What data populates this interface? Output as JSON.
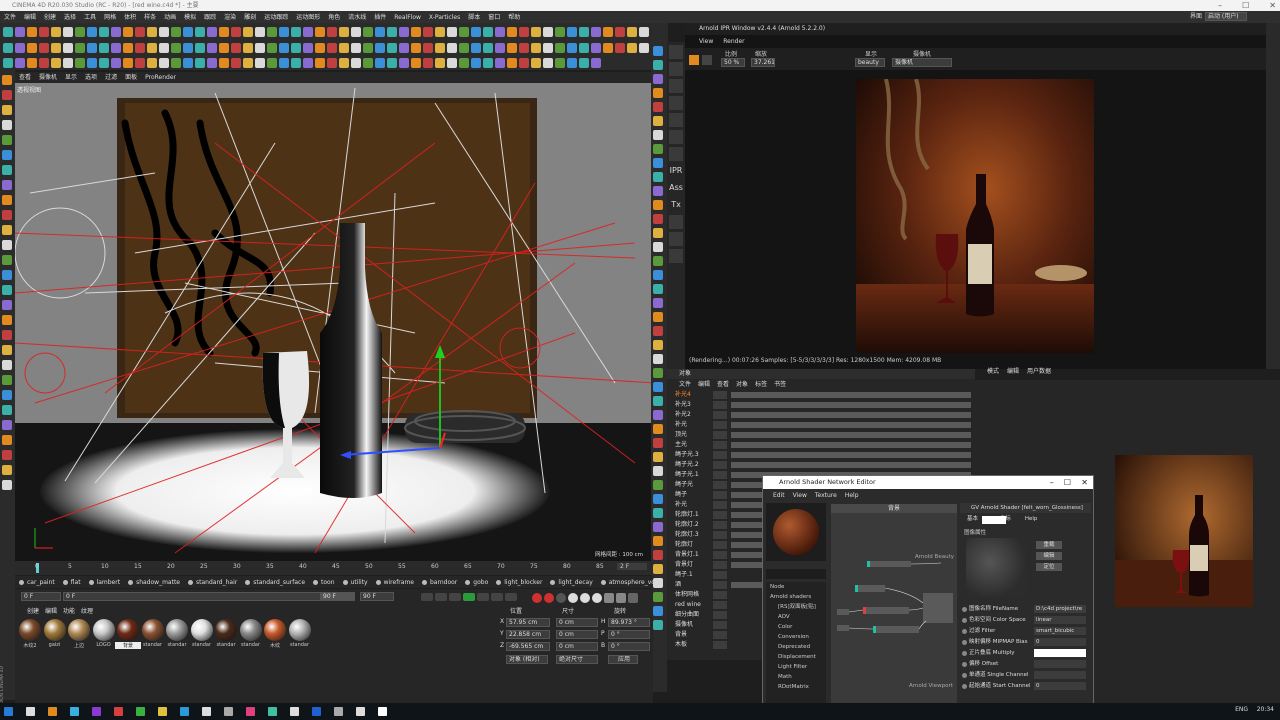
{
  "app": {
    "title": "CINEMA 4D R20.030 Studio (RC - R20) - [red wine.c4d *] - 主要",
    "layout_label": "界面",
    "layout_value": "启动 (用户)",
    "side_label": "MAXON CINEMA 4D"
  },
  "main_menu": [
    "文件",
    "编辑",
    "创建",
    "选择",
    "工具",
    "网格",
    "体积",
    "样条",
    "动画",
    "模拟",
    "跟踪",
    "渲染",
    "雕刻",
    "运动跟踪",
    "运动图形",
    "角色",
    "流水线",
    "插件",
    "RealFlow",
    "X-Particles",
    "脚本",
    "窗口",
    "帮助"
  ],
  "viewport": {
    "menu": [
      "查看",
      "摄像机",
      "显示",
      "选项",
      "过滤",
      "面板",
      "ProRender"
    ],
    "label": "透视视图",
    "grid_spacing": "网格间距 : 100 cm"
  },
  "right_toolbar": [
    "IPR",
    "Ass",
    "Tx"
  ],
  "arnold_ipr": {
    "title": "Arnold IPR Window v2.4.4 (Arnold 5.2.2.0)",
    "menu": [
      "View",
      "Render"
    ],
    "ratio_label": "比例",
    "zoom_label": "缩放",
    "display_label": "显示",
    "camera_label": "摄像机",
    "ratio_value": "50 %",
    "zoom_value": "37.261",
    "display_value": "beauty",
    "camera_value": "摄像机",
    "status": "(Rendering...) 00:07:26  Samples: [5-5/3/3/3/3/3]  Res: 1280x1500  Mem: 4209.08 MB"
  },
  "objects": {
    "header": "对象",
    "menu": [
      "文件",
      "编辑",
      "查看",
      "对象",
      "标签",
      "书签"
    ],
    "rows": [
      "补光4",
      "补光3",
      "补光2",
      "补光",
      "顶光",
      "主光",
      "绳子光.3",
      "绳子光.2",
      "绳子光.1",
      "绳子光",
      "绳子",
      "补光",
      "轮廓灯.1",
      "轮廓灯.2",
      "轮廓灯.3",
      "轮廓灯",
      "背景灯.1",
      "背景灯",
      "绳子.1",
      "酒",
      "体积网格",
      "red wine",
      "细分曲面",
      "摄像机",
      "背景",
      "木板"
    ]
  },
  "attributes": {
    "menu": [
      "模式",
      "编辑",
      "用户数据"
    ]
  },
  "shader_editor": {
    "title": "Arnold Shader Network Editor",
    "menu": [
      "Edit",
      "View",
      "Texture",
      "Help"
    ],
    "graph_title": "背景",
    "tree_header": "Node",
    "tree": [
      "Arnold shaders",
      "[RS]双面板[贴]",
      "AOV",
      "Color",
      "Conversion",
      "Deprecated",
      "Displacement",
      "Light Filter",
      "Math",
      "RDotMatrix"
    ],
    "beauty_label": "Arnold Beauty",
    "viewport_label": "Arnold Viewport",
    "node_title": "GV Arnold Shader [felt_worn_Glossiness]",
    "tabs": [
      "基本",
      "UV坐标",
      "Help"
    ],
    "section": "图像属性",
    "buttons": [
      "重载",
      "编辑",
      "定位"
    ],
    "params": [
      {
        "label": "图像名称 FileName",
        "value": "D:\\c4d project\\re"
      },
      {
        "label": "色彩空间 Color Space",
        "value": "linear"
      },
      {
        "label": "过滤 Filter",
        "value": "smart_bicubic"
      },
      {
        "label": "映射偏移 MIPMAP Bias",
        "value": "0"
      },
      {
        "label": "正片叠底 Multiply",
        "value": ""
      },
      {
        "label": "偏移 Offset",
        "value": ""
      },
      {
        "label": "单通道 Single Channel",
        "value": ""
      },
      {
        "label": "起始通道 Start Channel",
        "value": "0"
      }
    ]
  },
  "timeline": {
    "ticks": [
      "0",
      "5",
      "10",
      "15",
      "20",
      "25",
      "30",
      "35",
      "40",
      "45",
      "50",
      "55",
      "60",
      "65",
      "70",
      "75",
      "80",
      "85",
      "90"
    ],
    "current": "2 F",
    "start": "0 F",
    "start2": "0 F",
    "end": "90 F",
    "end2": "90 F"
  },
  "material_tags": [
    "car_paint",
    "flat",
    "lambert",
    "shadow_matte",
    "standard_hair",
    "standard_surface",
    "toon",
    "utility",
    "wireframe",
    "barndoor",
    "gobo",
    "light_blocker",
    "light_decay",
    "atmosphere_volume",
    "fog"
  ],
  "materials": {
    "menu": [
      "创建",
      "编辑",
      "功能",
      "纹理"
    ],
    "items": [
      {
        "name": "木纹2",
        "color": "#7a4a2a"
      },
      {
        "name": "gaizi",
        "color": "#a07a3a"
      },
      {
        "name": "上边",
        "color": "#b08a55"
      },
      {
        "name": "LOGO",
        "color": "#c8c8c8"
      },
      {
        "name": "背景",
        "color": "#6e2a14"
      },
      {
        "name": "standar",
        "color": "#8a5232"
      },
      {
        "name": "standar",
        "color": "#9c9c9c"
      },
      {
        "name": "standar",
        "color": "#e0e0e0"
      },
      {
        "name": "standar",
        "color": "#4a2a1a"
      },
      {
        "name": "standar",
        "color": "#8a8a8a"
      },
      {
        "name": "木纹",
        "color": "#c85a2a"
      },
      {
        "name": "standar",
        "color": "#b4b4b4"
      }
    ]
  },
  "coordinates": {
    "headers": [
      "位置",
      "尺寸",
      "旋转"
    ],
    "rows": [
      {
        "axis": "X",
        "pos": "57.95 cm",
        "size": "0 cm",
        "rot_label": "H",
        "rot": "89.973 °"
      },
      {
        "axis": "Y",
        "pos": "22.858 cm",
        "size": "0 cm",
        "rot_label": "P",
        "rot": "0 °"
      },
      {
        "axis": "Z",
        "pos": "-69.565 cm",
        "size": "0 cm",
        "rot_label": "B",
        "rot": "0 °"
      }
    ],
    "mode": "对象 (相对)",
    "size_mode": "绝对尺寸",
    "apply": "应用"
  },
  "taskbar": {
    "ime": "ENG",
    "time": "20:34"
  },
  "colors": {
    "accent": "#ff7a2a",
    "ui_dark": "#262626",
    "floor_red": "#e02020"
  }
}
